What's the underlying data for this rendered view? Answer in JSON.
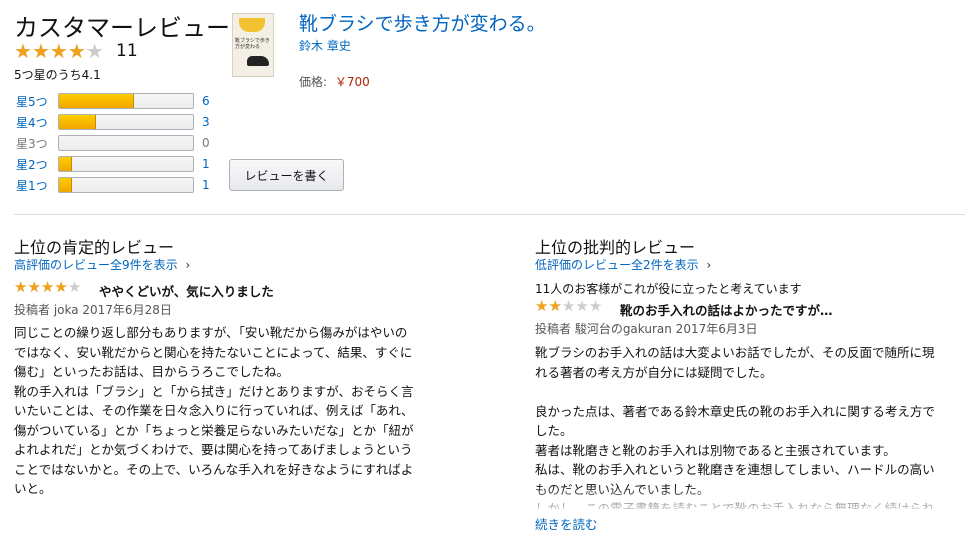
{
  "summary": {
    "title": "カスタマーレビュー",
    "rating": 4.1,
    "review_count": "11",
    "rating_text": "5つ星のうち4.1",
    "histogram": [
      {
        "label": "星5つ",
        "count": "6",
        "percent": 55
      },
      {
        "label": "星4つ",
        "count": "3",
        "percent": 27
      },
      {
        "label": "星3つ",
        "count": "0",
        "percent": 0
      },
      {
        "label": "星2つ",
        "count": "1",
        "percent": 9
      },
      {
        "label": "星1つ",
        "count": "1",
        "percent": 9
      }
    ],
    "write_review_label": "レビューを書く"
  },
  "product": {
    "title": "靴ブラシで歩き方が変わる。",
    "author": "鈴木 章史",
    "price_label": "価格:",
    "price": "￥700",
    "cover_text": "靴ブラシで歩き方が変わる"
  },
  "positive": {
    "heading": "上位の肯定的レビュー",
    "all_link": "高評価のレビュー全9件を表示",
    "rating": 4,
    "title": "ややくどいが、気に入りました",
    "byline": "投稿者 joka 2017年6月28日",
    "body": "同じことの繰り返し部分もありますが、「安い靴だから傷みがはやいの\nではなく、安い靴だからと関心を持たないことによって、結果、すぐに\n傷む」といったお話は、目からうろこでしたね。\n靴の手入れは「ブラシ」と「から拭き」だけとありますが、おそらく言\nいたいことは、その作業を日々念入りに行っていれば、例えば「あれ、\n傷がついている」とか「ちょっと栄養足らないみたいだな」とか「紐が\nよれよれだ」とか気づくわけで、要は関心を持ってあげましょうという\nことではないかと。その上で、いろんな手入れを好きなようにすればよ\nいと。"
  },
  "critical": {
    "heading": "上位の批判的レビュー",
    "all_link": "低評価のレビュー全2件を表示",
    "helpful": "11人のお客様がこれが役に立ったと考えています",
    "rating": 2,
    "title": "靴のお手入れの話はよかったですが…",
    "byline": "投稿者 駿河台のgakuran 2017年6月3日",
    "body": "靴ブラシのお手入れの話は大変よいお話でしたが、その反面で随所に現\nれる著者の考え方が自分には疑問でした。\n\n良かった点は、著者である鈴木章史氏の靴のお手入れに関する考え方で\nした。\n著者は靴磨きと靴のお手入れは別物であると主張されています。\n私は、靴のお手入れというと靴磨きを連想してしまい、ハードルの高い\nものだと思い込んでいました。\nしかし、この電子書籍を読むことで靴のお手入れなら無理なく続けられ",
    "read_more": "続きを読む"
  },
  "colors": {
    "star": "#f0a21d",
    "link": "#0066c0",
    "price": "#b12704"
  }
}
